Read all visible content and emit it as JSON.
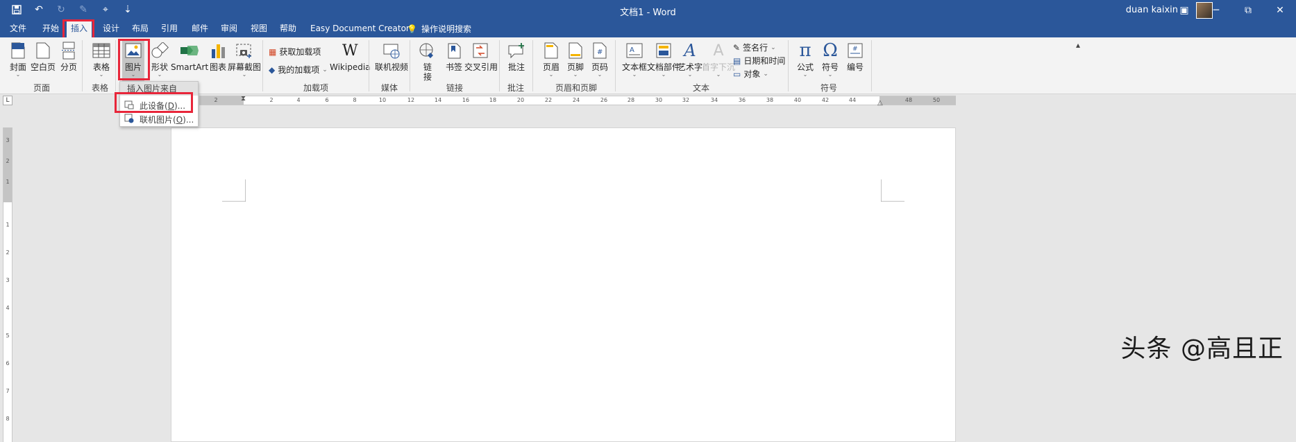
{
  "window": {
    "title": "文档1  -  Word",
    "user": "duan kaixin",
    "minimize": "─",
    "restore": "⧉",
    "close": "✕",
    "ribbon_display": "▣"
  },
  "qat": {
    "more": "⇣"
  },
  "tabs": [
    "文件",
    "开始",
    "插入",
    "设计",
    "布局",
    "引用",
    "邮件",
    "审阅",
    "视图",
    "帮助",
    "Easy Document Creator"
  ],
  "tell_me": "操作说明搜索",
  "ribbon": {
    "pages": {
      "cover": "封面",
      "blank": "空白页",
      "break": "分页",
      "group": "页面"
    },
    "tables": {
      "table": "表格",
      "group": "表格"
    },
    "illustrations": {
      "picture": "图片",
      "shapes": "形状",
      "smartart": "SmartArt",
      "chart": "图表",
      "screenshot": "屏幕截图"
    },
    "addins": {
      "get": "获取加载项",
      "mine": "我的加载项",
      "wikipedia": "Wikipedia",
      "group": "加载项"
    },
    "media": {
      "video": "联机视频",
      "group": "媒体"
    },
    "links": {
      "link": "链接",
      "bookmark": "书签",
      "crossref": "交叉引用",
      "group": "链接"
    },
    "comments": {
      "comment": "批注",
      "group": "批注"
    },
    "headerfooter": {
      "header": "页眉",
      "footer": "页脚",
      "pagenum": "页码",
      "group": "页眉和页脚"
    },
    "text": {
      "textbox": "文本框",
      "parts": "文档部件",
      "wordart": "艺术字",
      "dropcap": "首字下沉",
      "signature": "签名行",
      "datetime": "日期和时间",
      "object": "对象",
      "group": "文本"
    },
    "symbols": {
      "equation": "公式",
      "symbol": "符号",
      "number": "编号",
      "group": "符号"
    }
  },
  "dropdown": {
    "header": "插入图片来自",
    "items": [
      {
        "prefix": "此设备(",
        "key": "D",
        "suffix": ")..."
      },
      {
        "prefix": "联机图片(",
        "key": "O",
        "suffix": ")..."
      }
    ]
  },
  "ruler": {
    "h_labels": [
      "2",
      "2",
      "4",
      "6",
      "8",
      "10",
      "12",
      "14",
      "16",
      "18",
      "20",
      "22",
      "24",
      "26",
      "28",
      "30",
      "32",
      "34",
      "36",
      "38",
      "40",
      "42",
      "44",
      "48",
      "50"
    ],
    "v_labels": [
      "3",
      "2",
      "1",
      "1",
      "2",
      "3",
      "4",
      "5",
      "6",
      "7",
      "8"
    ]
  },
  "tabstop": "L",
  "watermark": "头条 @高且正",
  "colors": {
    "titlebar": "#2b579a",
    "highlight": "#e8263a",
    "ribbon": "#f3f3f3"
  }
}
